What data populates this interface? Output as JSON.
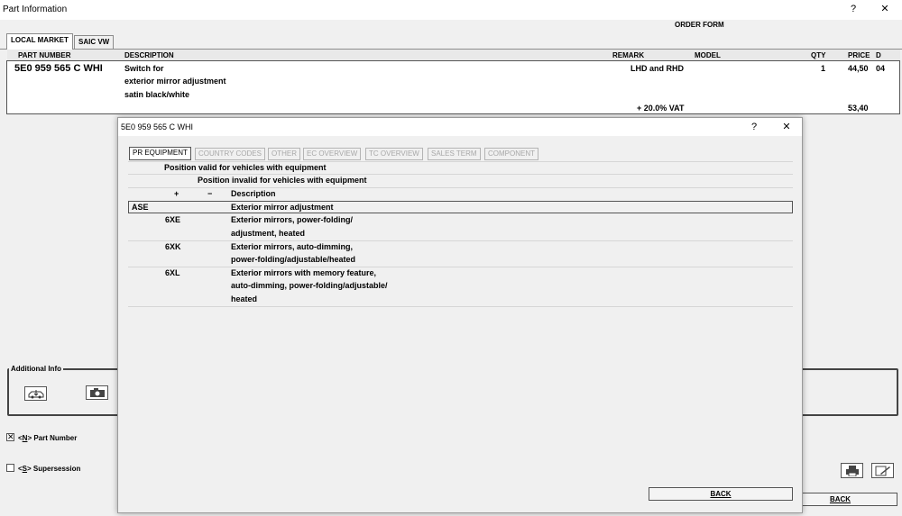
{
  "window": {
    "title": "Part Information",
    "help": "?",
    "close": "✕",
    "order_form": "ORDER FORM"
  },
  "tabs": [
    "LOCAL MARKET",
    "SAIC VW"
  ],
  "parts_table": {
    "headers": {
      "part_number": "PART NUMBER",
      "description": "DESCRIPTION",
      "remark": "REMARK",
      "model": "MODEL",
      "qty": "QTY",
      "price": "PRICE",
      "d": "D"
    },
    "row": {
      "part_number": "5E0 959 565 C  WHI",
      "description": [
        "Switch for",
        "exterior mirror adjustment",
        "satin black/white"
      ],
      "remark": "LHD and RHD",
      "qty": "1",
      "price": "44,50",
      "d": "04",
      "vat_label": "+ 20.0% VAT",
      "vat_price": "53,40"
    }
  },
  "additional_info": {
    "legend": "Additional Info",
    "icons": [
      "vehicle-icon",
      "camera-icon"
    ]
  },
  "options": [
    {
      "label_pre": "<",
      "key": "N",
      "label_post": "> Part Number",
      "checked": true
    },
    {
      "label_pre": "<",
      "key": "S",
      "label_post": "> Supersession",
      "checked": false
    }
  ],
  "main_back": "BACK",
  "dialog": {
    "title": "5E0 959 565 C  WHI",
    "help": "?",
    "close": "✕",
    "tabs": [
      "PR EQUIPMENT",
      "COUNTRY CODES",
      "OTHER",
      "EC OVERVIEW",
      "TC OVERVIEW",
      "SALES TERM",
      "COMPONENT"
    ],
    "valid_text": "Position valid for vehicles with equipment",
    "invalid_text": "Position invalid for vehicles with equipment",
    "col_plus": "+",
    "col_minus": "−",
    "col_description": "Description",
    "family": {
      "code": "ASE",
      "description": "Exterior mirror adjustment"
    },
    "items": [
      {
        "code": "6XE",
        "lines": [
          "Exterior mirrors, power-folding/",
          "adjustment, heated"
        ]
      },
      {
        "code": "6XK",
        "lines": [
          "Exterior mirrors, auto-dimming,",
          "power-folding/adjustable/heated"
        ]
      },
      {
        "code": "6XL",
        "lines": [
          "Exterior mirrors with memory feature,",
          "auto-dimming, power-folding/adjustable/",
          "heated"
        ]
      }
    ],
    "back": "BACK"
  }
}
